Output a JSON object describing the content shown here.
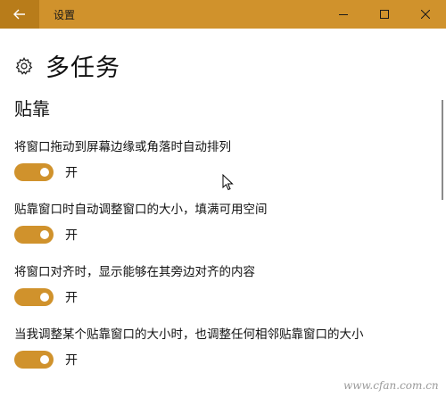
{
  "window": {
    "title": "设置",
    "accent": "#d0922c",
    "back_icon": "arrow-left-icon"
  },
  "page": {
    "title": "多任务",
    "icon": "gear-icon"
  },
  "section": {
    "title": "贴靠"
  },
  "settings": [
    {
      "label": "将窗口拖动到屏幕边缘或角落时自动排列",
      "state": "开"
    },
    {
      "label": "贴靠窗口时自动调整窗口的大小，填满可用空间",
      "state": "开"
    },
    {
      "label": "将窗口对齐时，显示能够在其旁边对齐的内容",
      "state": "开"
    },
    {
      "label": "当我调整某个贴靠窗口的大小时，也调整任何相邻贴靠窗口的大小",
      "state": "开"
    }
  ],
  "watermark": "www.cfan.com.cn"
}
